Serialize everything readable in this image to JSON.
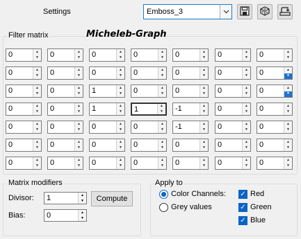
{
  "header": {
    "settings_label": "Settings",
    "preset_value": "Emboss_3",
    "icons": [
      "save-icon",
      "dice-icon",
      "reset-icon"
    ]
  },
  "filter_matrix": {
    "title": "Filter matrix",
    "watermark": "Micheleb-Graph",
    "rows": [
      [
        "0",
        "0",
        "0",
        "0",
        "0",
        "0",
        "0"
      ],
      [
        "0",
        "0",
        "0",
        "0",
        "0",
        "0",
        "0"
      ],
      [
        "0",
        "0",
        "1",
        "0",
        "0",
        "0",
        "0"
      ],
      [
        "0",
        "0",
        "1",
        "1",
        "-1",
        "0",
        "0"
      ],
      [
        "0",
        "0",
        "0",
        "0",
        "-1",
        "0",
        "0"
      ],
      [
        "0",
        "0",
        "0",
        "0",
        "0",
        "0",
        "0"
      ],
      [
        "0",
        "0",
        "0",
        "0",
        "0",
        "0",
        "0"
      ]
    ]
  },
  "matrix_modifiers": {
    "title": "Matrix modifiers",
    "divisor_label": "Divisor:",
    "divisor_value": "1",
    "bias_label": "Bias:",
    "bias_value": "0",
    "compute_label": "Compute"
  },
  "apply_to": {
    "title": "Apply to",
    "color_channels_label": "Color Channels:",
    "grey_values_label": "Grey values",
    "selected": "color_channels",
    "red_label": "Red",
    "green_label": "Green",
    "blue_label": "Blue"
  },
  "colors": {
    "accent": "#0a64c8",
    "focus_border": "#1979ca",
    "window_bg": "#f0f0f0"
  }
}
